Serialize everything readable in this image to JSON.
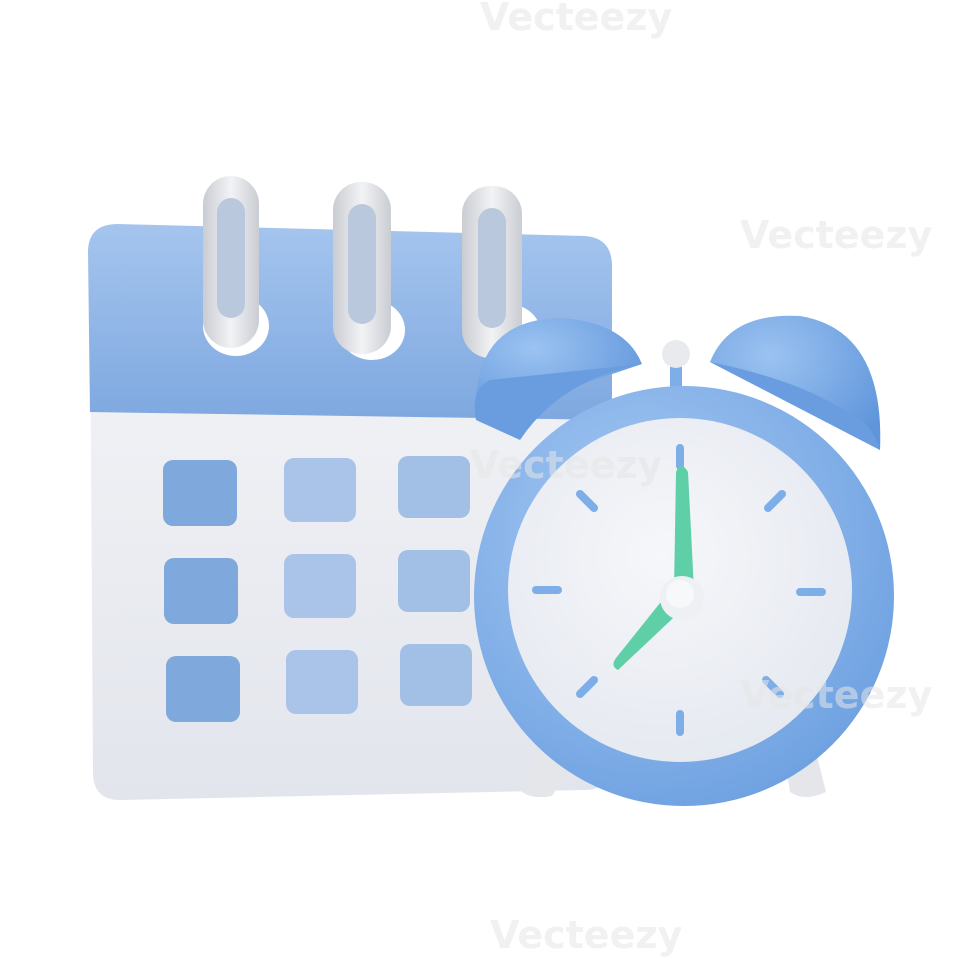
{
  "watermark": {
    "text": "Vecteezy"
  },
  "colors": {
    "background": "#ffffff",
    "calendar_header": "#8fb6e8",
    "calendar_body": "#eef0f4",
    "day_tile": "#7fa8dc",
    "day_tile_light": "#a9c4e8",
    "ring": "#e2e4e8",
    "clock_rim": "#7eaee8",
    "clock_face": "#eef0f4",
    "clock_hand": "#5fcfa8",
    "bell": "#7eaee8",
    "leg": "#e4e6ea"
  },
  "objects": {
    "calendar_icon": "calendar-icon",
    "clock_icon": "alarm-clock-icon"
  },
  "clock": {
    "hour": 7,
    "minute": 0
  }
}
